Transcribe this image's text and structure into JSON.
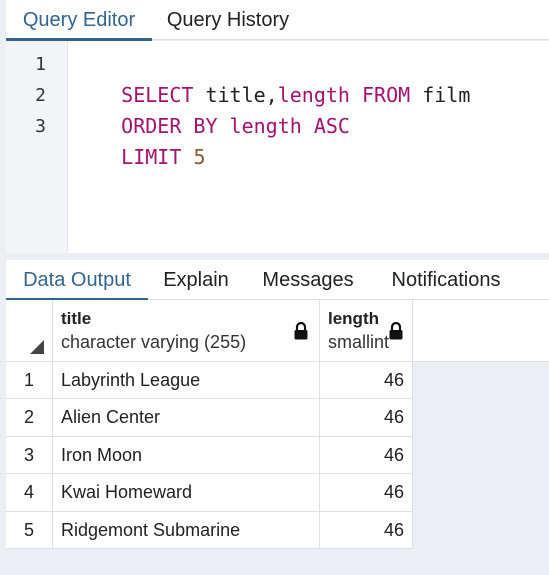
{
  "editor_tabs": [
    {
      "label": "Query Editor",
      "active": true
    },
    {
      "label": "Query History",
      "active": false
    }
  ],
  "editor": {
    "lines": [
      {
        "number": "1",
        "tokens": [
          {
            "text": "SELECT",
            "kind": "keyword"
          },
          {
            "text": " title,",
            "kind": "plain"
          },
          {
            "text": "length",
            "kind": "keyword"
          },
          {
            "text": " ",
            "kind": "plain"
          },
          {
            "text": "FROM",
            "kind": "keyword"
          },
          {
            "text": " film",
            "kind": "plain"
          }
        ]
      },
      {
        "number": "2",
        "tokens": [
          {
            "text": "ORDER BY length ASC",
            "kind": "keyword"
          }
        ]
      },
      {
        "number": "3",
        "tokens": [
          {
            "text": "LIMIT",
            "kind": "keyword"
          },
          {
            "text": " ",
            "kind": "plain"
          },
          {
            "text": "5",
            "kind": "number"
          }
        ]
      }
    ]
  },
  "output_tabs": [
    {
      "label": "Data Output",
      "active": true
    },
    {
      "label": "Explain",
      "active": false
    },
    {
      "label": "Messages",
      "active": false
    },
    {
      "label": "Notifications",
      "active": false
    }
  ],
  "grid": {
    "columns": [
      {
        "name": "title",
        "type": "character varying (255)",
        "locked": true
      },
      {
        "name": "length",
        "type": "smallint",
        "locked": true
      }
    ],
    "rows": [
      {
        "num": "1",
        "title": "Labyrinth League",
        "length": "46"
      },
      {
        "num": "2",
        "title": "Alien Center",
        "length": "46"
      },
      {
        "num": "3",
        "title": "Iron Moon",
        "length": "46"
      },
      {
        "num": "4",
        "title": "Kwai Homeward",
        "length": "46"
      },
      {
        "num": "5",
        "title": "Ridgemont Submarine",
        "length": "46"
      }
    ]
  },
  "colors": {
    "accent": "#326690",
    "keyword": "#a2136f",
    "number": "#8a5a32",
    "background": "#ebeef3"
  }
}
